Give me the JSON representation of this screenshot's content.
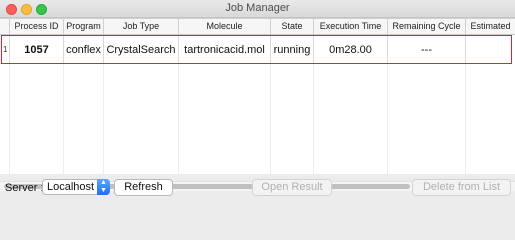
{
  "window": {
    "title": "Job Manager"
  },
  "table": {
    "columns": [
      "Process ID",
      "Program",
      "Job Type",
      "Molecule",
      "State",
      "Execution Time",
      "Remaining Cycle",
      "Estimated"
    ],
    "rows": [
      {
        "index": "1",
        "cells": [
          "1057",
          "conflex",
          "CrystalSearch",
          "tartronicacid.mol",
          "running",
          "0m28.00",
          "---",
          ""
        ]
      }
    ]
  },
  "footer": {
    "server_label": "Server :",
    "server_value": "Localhost",
    "refresh_label": "Refresh",
    "open_result_label": "Open Result",
    "delete_label": "Delete from List"
  },
  "colors": {
    "highlight": "#e8212b",
    "select_arrow": "#1f6ff0"
  }
}
